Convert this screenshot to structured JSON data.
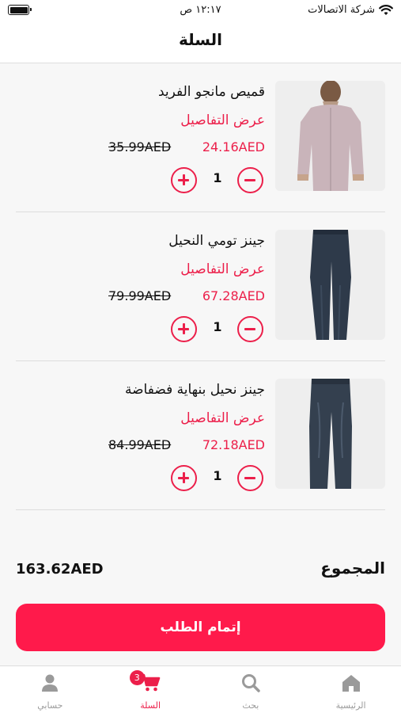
{
  "status_bar": {
    "carrier": "شركة الاتصالات",
    "time": "١٢:١٧ ص"
  },
  "header": {
    "title": "السلة"
  },
  "cart": {
    "items": [
      {
        "name": "قميص مانجو الفريد",
        "details_link": "عرض التفاصيل",
        "price": "24.16AED",
        "old_price": "35.99AED",
        "quantity": "1"
      },
      {
        "name": "جينز تومي النحيل",
        "details_link": "عرض التفاصيل",
        "price": "67.28AED",
        "old_price": "79.99AED",
        "quantity": "1"
      },
      {
        "name": "جينز نحيل بنهاية فضفاضة",
        "details_link": "عرض التفاصيل",
        "price": "72.18AED",
        "old_price": "84.99AED",
        "quantity": "1"
      }
    ],
    "total_label": "المجموع",
    "total_value": "163.62AED",
    "checkout_label": "إتمام الطلب"
  },
  "tab_bar": {
    "tabs": [
      {
        "label": "الرئيسية",
        "icon": "home-icon"
      },
      {
        "label": "بحث",
        "icon": "search-icon"
      },
      {
        "label": "السلة",
        "icon": "cart-icon",
        "badge": "3"
      },
      {
        "label": "حسابي",
        "icon": "user-icon"
      }
    ],
    "active_tab": "السلة"
  },
  "colors": {
    "accent": "#ec1f4a",
    "button": "#ff1a4b",
    "background": "#f7f7f7",
    "inactive": "#9a9a9a"
  }
}
